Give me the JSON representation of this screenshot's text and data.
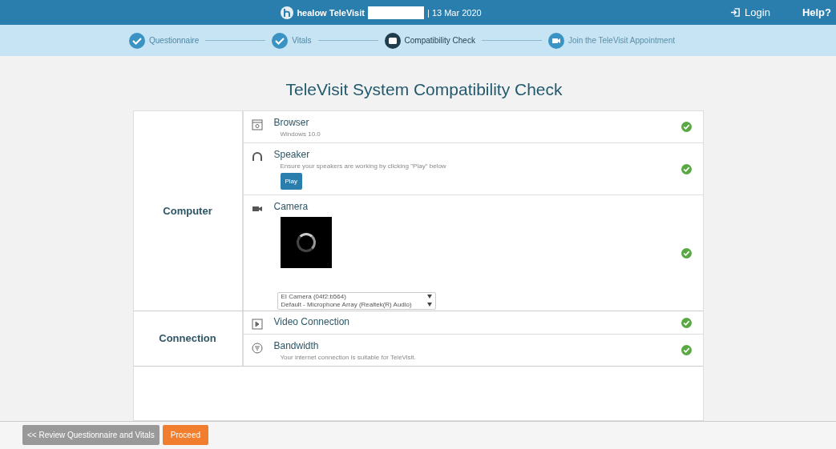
{
  "header": {
    "brand": "healow TeleVisit",
    "date": "| 13 Mar 2020",
    "login": "Login",
    "help": "Help?"
  },
  "steps": [
    {
      "label": "Questionnaire",
      "completed": true,
      "selected": false
    },
    {
      "label": "Vitals",
      "completed": true,
      "selected": false
    },
    {
      "label": "Compatibility Check",
      "completed": false,
      "selected": true
    },
    {
      "label": "Join the TeleVisit Appointment",
      "completed": false,
      "selected": false
    }
  ],
  "title": "TeleVisit System Compatibility Check",
  "groups": [
    {
      "name": "Computer",
      "items": [
        {
          "kind": "browser",
          "title": "Browser",
          "detail": "Windows 10.0",
          "passed": true
        },
        {
          "kind": "speaker",
          "title": "Speaker",
          "detail": "Ensure your speakers are working by clicking \"Play\" below",
          "button": "Play",
          "passed": true
        },
        {
          "kind": "camera",
          "title": "Camera",
          "camera_select": "EI Camera (04f2:b564)",
          "mic_select": "Default - Microphone Array (Realtek(R) Audio)",
          "passed": true
        }
      ]
    },
    {
      "name": "Connection",
      "items": [
        {
          "kind": "video",
          "title": "Video Connection",
          "passed": true
        },
        {
          "kind": "bandwidth",
          "title": "Bandwidth",
          "detail": "Your internet connection is suitable for TeleVisit.",
          "passed": true
        }
      ]
    }
  ],
  "footer": {
    "back": "<< Review Questionnaire and Vitals",
    "proceed": "Proceed"
  }
}
